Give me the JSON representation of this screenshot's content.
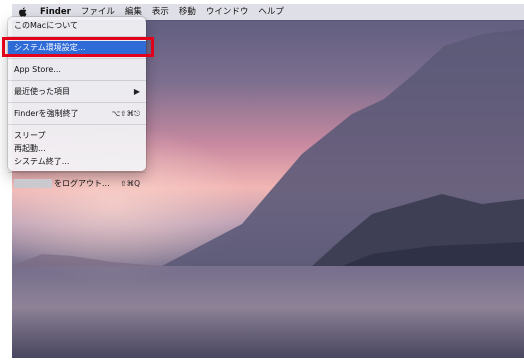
{
  "menubar": {
    "app_name": "Finder",
    "items": [
      "ファイル",
      "編集",
      "表示",
      "移動",
      "ウインドウ",
      "ヘルプ"
    ]
  },
  "apple_menu": {
    "about": "このMacについて",
    "system_prefs": "システム環境設定...",
    "app_store": "App Store...",
    "recent_items": "最近使った項目",
    "force_quit": "Finderを強制終了",
    "force_quit_shortcut": "⌥⇧⌘⎋",
    "sleep": "スリープ",
    "restart": "再起動...",
    "shutdown": "システム終了...",
    "logout": "をログアウト...",
    "logout_shortcut": "⇧⌘Q"
  },
  "colors": {
    "selection": "#2f6bd7",
    "highlight_box": "#e2001a"
  }
}
